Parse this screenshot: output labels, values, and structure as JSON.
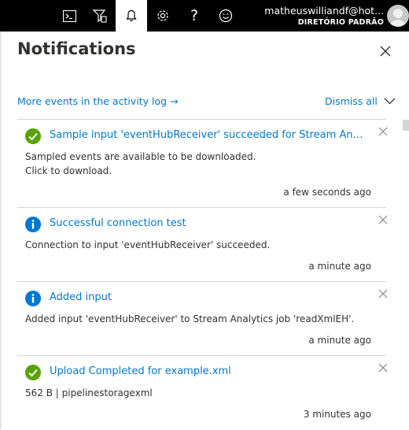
{
  "topbar": {
    "icons": [
      "cloud-shell-icon",
      "directory-filter-icon",
      "notifications-bell-icon",
      "settings-gear-icon",
      "help-icon",
      "feedback-smiley-icon"
    ],
    "help_glyph": "?",
    "user": {
      "email": "matheuswilliandf@hot...",
      "directory": "DIRETÓRIO PADRÃO"
    }
  },
  "panel": {
    "title": "Notifications",
    "activity_log_link": "More events in the activity log",
    "activity_log_arrow": "→",
    "dismiss_label": "Dismiss all"
  },
  "notifications": [
    {
      "status": "success",
      "title": "Sample input 'eventHubReceiver' succeeded for Stream Analytic...",
      "body_line1": "Sampled events are available to be downloaded.",
      "body_line2": "Click to download.",
      "time": "a few seconds ago"
    },
    {
      "status": "info",
      "title": "Successful connection test",
      "body_line1": "Connection to input 'eventHubReceiver' succeeded.",
      "time": "a minute ago"
    },
    {
      "status": "info",
      "title": "Added input",
      "body_line1": "Added input 'eventHubReceiver' to Stream Analytics job 'readXmlEH'.",
      "time": "a minute ago"
    },
    {
      "status": "success",
      "title": "Upload Completed for example.xml",
      "body_line1": "562 B | pipelinestoragexml",
      "time": "3 minutes ago"
    }
  ],
  "colors": {
    "topbar": "#000000",
    "link": "#0078d4",
    "success": "#57a300",
    "info": "#0078d4",
    "text": "#323130"
  }
}
